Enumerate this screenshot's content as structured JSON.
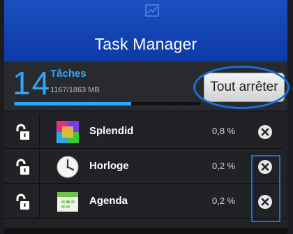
{
  "header": {
    "title": "Task Manager",
    "app_icon": "chart-icon"
  },
  "stats": {
    "task_count": "14",
    "tasks_label": "Tâches",
    "memory_text": "1167/1863 MB",
    "memory_fraction": 0.626
  },
  "stop_all_label": "Tout arrêter",
  "tasks": [
    {
      "name": "Splendid",
      "cpu": "0,8 %",
      "icon": "splendid-app-icon"
    },
    {
      "name": "Horloge",
      "cpu": "0,2 %",
      "icon": "clock-app-icon"
    },
    {
      "name": "Agenda",
      "cpu": "0,2 %",
      "icon": "calendar-app-icon"
    }
  ],
  "colors": {
    "accent": "#2ea7ff",
    "header": "#1a4fbf",
    "highlight": "#1c6fd6"
  }
}
